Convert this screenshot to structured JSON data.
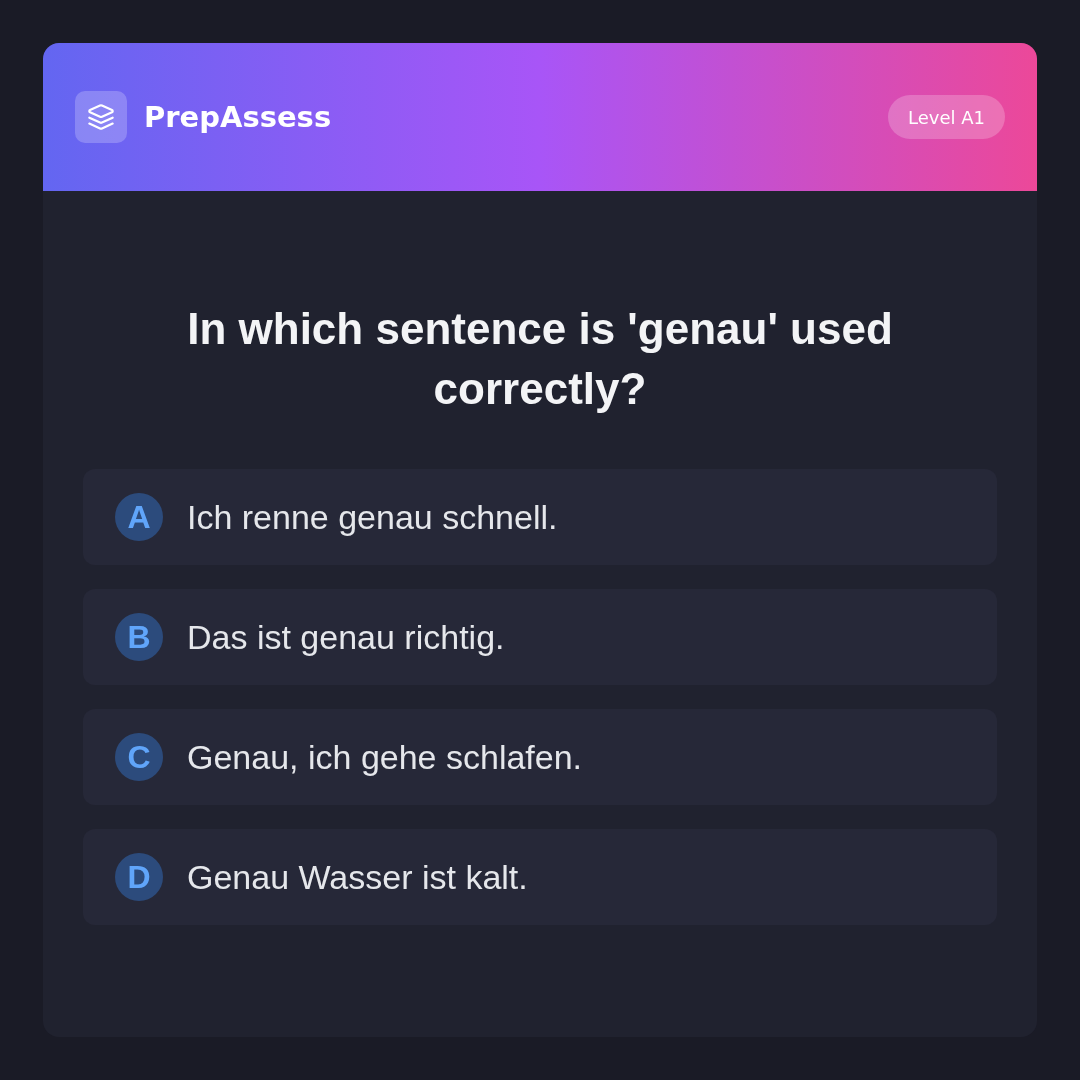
{
  "header": {
    "brand": "PrepAssess",
    "level_badge": "Level A1"
  },
  "question": "In which sentence is 'genau' used correctly?",
  "options": [
    {
      "letter": "A",
      "text": "Ich renne genau schnell.",
      "selected": false
    },
    {
      "letter": "B",
      "text": "Das ist genau richtig.",
      "selected": false
    },
    {
      "letter": "C",
      "text": "Genau, ich gehe schlafen.",
      "selected": false
    },
    {
      "letter": "D",
      "text": "Genau Wasser ist kalt.",
      "selected": false
    }
  ]
}
